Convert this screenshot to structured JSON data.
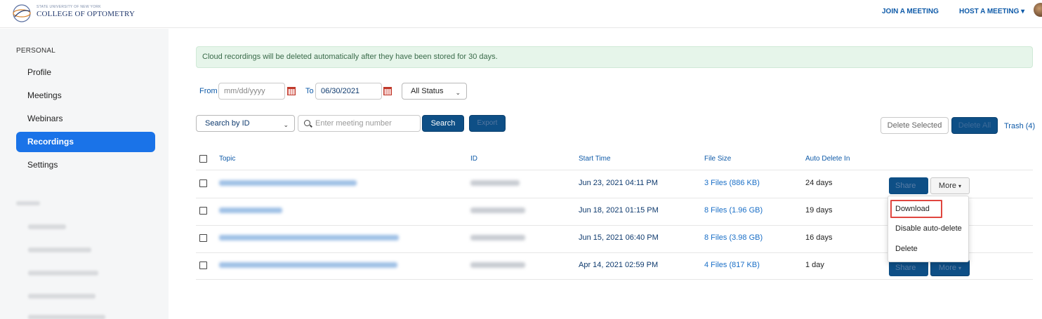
{
  "header": {
    "logo_subtext": "STATE UNIVERSITY OF NEW YORK",
    "logo_text": "COLLEGE OF OPTOMETRY",
    "join_meeting": "JOIN A MEETING",
    "host_meeting": "HOST A MEETING",
    "host_caret": "▾"
  },
  "sidebar": {
    "section_label": "PERSONAL",
    "items": [
      {
        "label": "Profile"
      },
      {
        "label": "Meetings"
      },
      {
        "label": "Webinars"
      },
      {
        "label": "Recordings",
        "active": true
      },
      {
        "label": "Settings"
      }
    ]
  },
  "notice": "Cloud recordings will be deleted automatically after they have been stored for 30 days.",
  "filters": {
    "from_label": "From",
    "from_placeholder": "mm/dd/yyyy",
    "to_label": "To",
    "to_value": "06/30/2021",
    "status_value": "All Status",
    "search_by_value": "Search by ID",
    "search_placeholder": "Enter meeting number",
    "search_button": "Search",
    "export_button": "Export"
  },
  "actions": {
    "delete_selected": "Delete Selected",
    "delete_all": "Delete All",
    "trash": "Trash (4)"
  },
  "table": {
    "columns": [
      "Topic",
      "ID",
      "Start Time",
      "File Size",
      "Auto Delete In"
    ],
    "rows": [
      {
        "start_time": "Jun 23, 2021 04:11 PM",
        "file_size": "3 Files (886 KB)",
        "auto_delete": "24 days"
      },
      {
        "start_time": "Jun 18, 2021 01:15 PM",
        "file_size": "8 Files (1.96 GB)",
        "auto_delete": "19 days"
      },
      {
        "start_time": "Jun 15, 2021 06:40 PM",
        "file_size": "8 Files (3.98 GB)",
        "auto_delete": "16 days"
      },
      {
        "start_time": "Apr 14, 2021 02:59 PM",
        "file_size": "4 Files (817 KB)",
        "auto_delete": "1 day"
      }
    ],
    "share_label": "Share",
    "more_label": "More",
    "more_caret": "▾"
  },
  "more_menu": {
    "items": [
      "Download",
      "Disable auto-delete",
      "Delete"
    ]
  },
  "colors": {
    "accent": "#1a73e8",
    "primary_button": "#0e4f86",
    "link": "#0e5aa8",
    "notice_bg": "#e6f5ea",
    "highlight": "#e0463f"
  }
}
